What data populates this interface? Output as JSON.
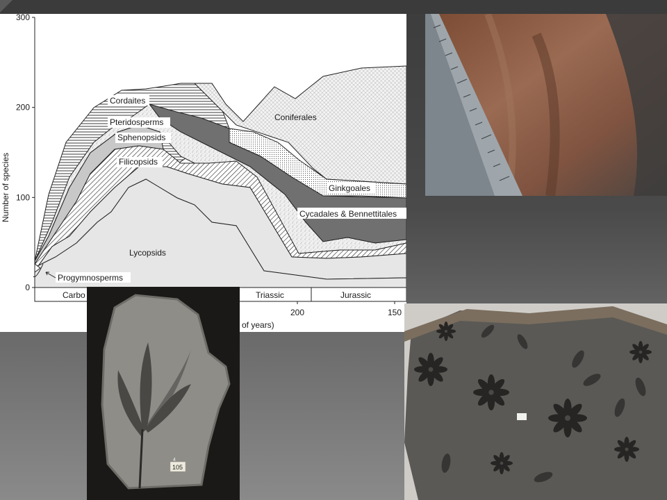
{
  "chart_data": {
    "type": "area",
    "ylabel": "Number of species",
    "xlabel_fragment": "of years)",
    "yticks": [
      0,
      100,
      200,
      300
    ],
    "ylim": [
      0,
      300
    ],
    "xticks": [
      "200",
      "150"
    ],
    "period_labels": [
      "Carbo",
      "Triassic",
      "Jurassic"
    ],
    "series": [
      {
        "name": "Progymnosperms"
      },
      {
        "name": "Lycopsids"
      },
      {
        "name": "Filicopsids"
      },
      {
        "name": "Sphenopsids"
      },
      {
        "name": "Pteridosperms"
      },
      {
        "name": "Cordaites"
      },
      {
        "name": "Coniferales"
      },
      {
        "name": "Ginkgoales"
      },
      {
        "name": "Cycadales & Bennettitales"
      }
    ]
  },
  "photos": {
    "leaf_fossil_tag": "105",
    "leaf_fossil_tag_small": "4"
  }
}
